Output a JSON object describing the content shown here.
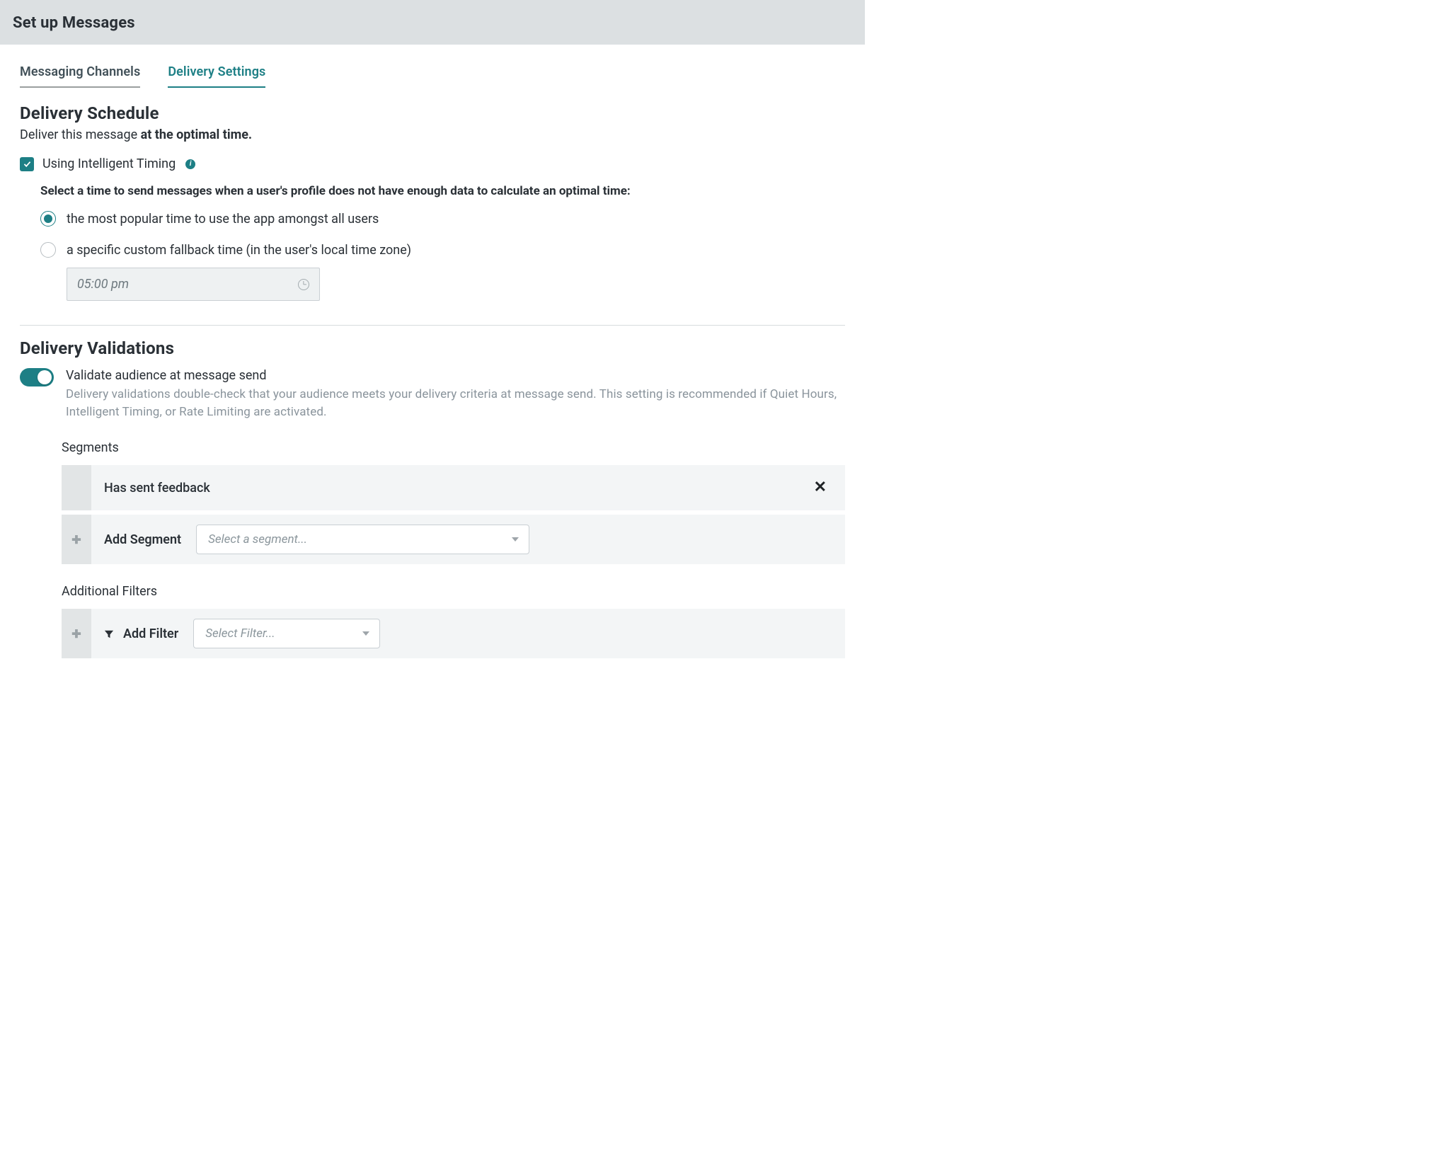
{
  "header": {
    "title": "Set up Messages"
  },
  "tabs": [
    {
      "label": "Messaging Channels",
      "active": false
    },
    {
      "label": "Delivery Settings",
      "active": true
    }
  ],
  "schedule": {
    "title": "Delivery Schedule",
    "subtitle_prefix": "Deliver this message ",
    "subtitle_bold": "at the optimal time.",
    "intelligent_timing_label": "Using Intelligent Timing",
    "intelligent_timing_checked": true,
    "fallback_heading": "Select a time to send messages when a user's profile does not have enough data to calculate an optimal time:",
    "options": [
      {
        "label": "the most popular time to use the app amongst all users",
        "selected": true
      },
      {
        "label": "a specific custom fallback time (in the user's local time zone)",
        "selected": false
      }
    ],
    "fallback_time_value": "05:00 pm"
  },
  "validations": {
    "title": "Delivery Validations",
    "toggle_on": true,
    "toggle_label": "Validate audience at message send",
    "toggle_description": "Delivery validations double-check that your audience meets your delivery criteria at message send. This setting is recommended if Quiet Hours, Intelligent Timing, or Rate Limiting are activated.",
    "segments_title": "Segments",
    "segments": [
      {
        "name": "Has sent feedback"
      }
    ],
    "add_segment_label": "Add Segment",
    "segment_select_placeholder": "Select a segment...",
    "filters_title": "Additional Filters",
    "add_filter_label": "Add Filter",
    "filter_select_placeholder": "Select Filter..."
  }
}
